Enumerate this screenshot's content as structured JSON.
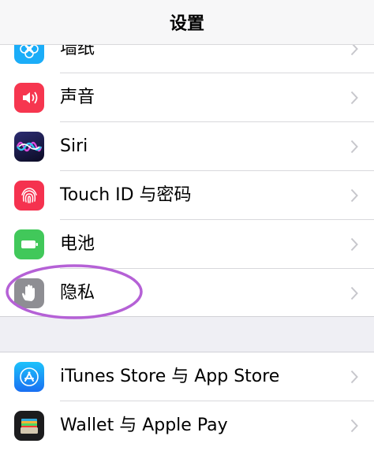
{
  "nav": {
    "title": "设置"
  },
  "settings_group_1": [
    {
      "label": "墙纸",
      "icon": "wallpaper-icon",
      "color": "#1badf8"
    },
    {
      "label": "声音",
      "icon": "speaker-icon",
      "color": "#f6364f"
    },
    {
      "label": "Siri",
      "icon": "siri-icon",
      "color": "#1a1c48"
    },
    {
      "label": "Touch ID 与密码",
      "icon": "fingerprint-icon",
      "color": "#f5324f"
    },
    {
      "label": "电池",
      "icon": "battery-icon",
      "color": "#41c85a"
    },
    {
      "label": "隐私",
      "icon": "hand-icon",
      "color": "#8e8e93"
    }
  ],
  "settings_group_2": [
    {
      "label": "iTunes Store 与 App Store",
      "icon": "app-store-icon",
      "color": "#1a8cf5"
    },
    {
      "label": "Wallet 与 Apple Pay",
      "icon": "wallet-icon",
      "color": "#1c1c1e"
    }
  ],
  "annotation": {
    "color": "#b561d6"
  }
}
